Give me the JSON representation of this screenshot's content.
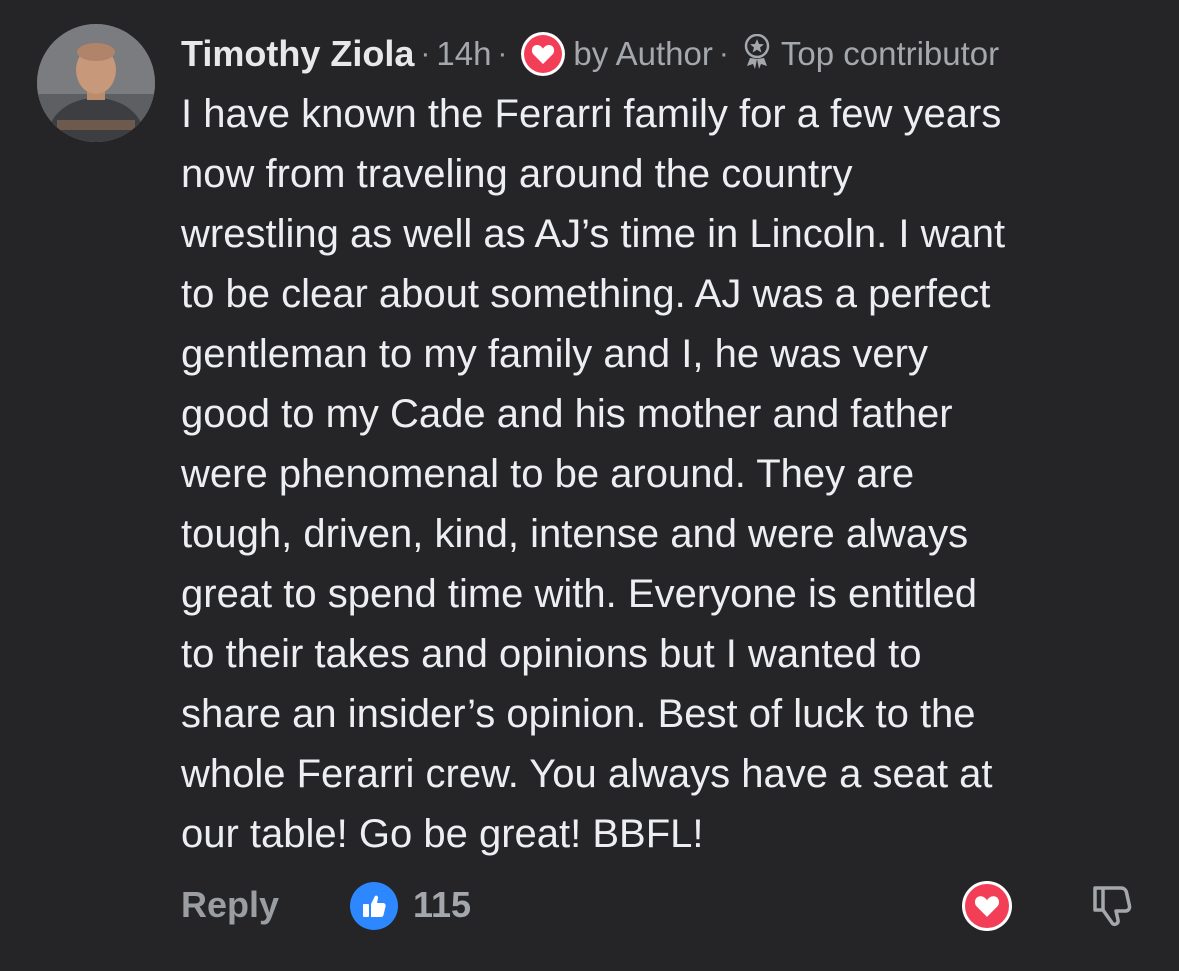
{
  "comment": {
    "author": "Timothy Ziola",
    "separator": "·",
    "time": "14h",
    "liked_by_label": "by Author",
    "badge_label": "Top contributor",
    "text": "I have known the Ferarri family for a few years\nnow from traveling around the country\nwrestling as well as AJ’s time in Lincoln. I want\nto be clear about something. AJ was a perfect\ngentleman to my family and I, he was very\ngood to my Cade and his mother and father\nwere phenomenal to be around. They are\ntough, driven, kind, intense and were always\ngreat to spend time with. Everyone is entitled\nto their takes and opinions but I wanted to\nshare an insider’s opinion. Best of luck to the\nwhole Ferarri crew. You always have a seat at\nour table! Go be great! BBFL!"
  },
  "actions": {
    "reply_label": "Reply",
    "like_count": "115"
  },
  "icons": {
    "avatar": "avatar",
    "love": "heart-icon",
    "badge": "top-contributor-icon",
    "like": "thumbs-up-icon",
    "dislike": "thumbs-down-icon"
  },
  "colors": {
    "background": "#252527",
    "text": "#eceef1",
    "meta": "#a4a7ac",
    "like_blue": "#2d88ff",
    "love_red": "#f33e58"
  }
}
